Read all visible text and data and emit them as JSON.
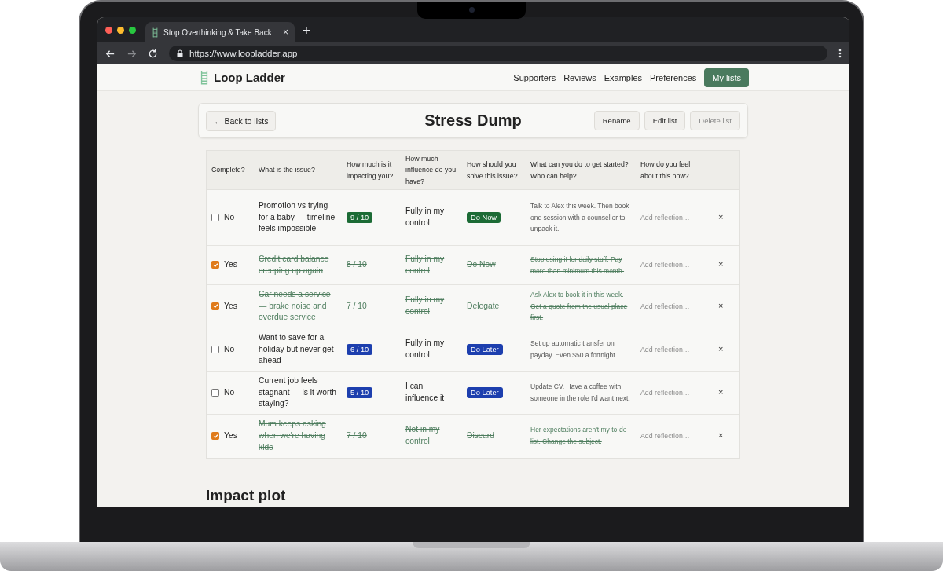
{
  "browser": {
    "tab_title": "Stop Overthinking & Take Back",
    "new_tab": "+",
    "tab_close": "×",
    "url": "https://www.loopladder.app"
  },
  "nav": {
    "brand": "Loop Ladder",
    "items": [
      {
        "label": "Supporters",
        "selected": false
      },
      {
        "label": "Reviews",
        "selected": false
      },
      {
        "label": "Examples",
        "selected": false
      },
      {
        "label": "Preferences",
        "selected": false
      },
      {
        "label": "My lists",
        "selected": true
      }
    ]
  },
  "header": {
    "back": "← Back to lists",
    "title": "Stress Dump",
    "actions": [
      {
        "label": "Rename",
        "disabled": false
      },
      {
        "label": "Edit list",
        "disabled": false
      },
      {
        "label": "Delete list",
        "disabled": true
      }
    ]
  },
  "table": {
    "columns": [
      "Complete?",
      "What is the issue?",
      "How much is it impacting you?",
      "How much influence do you have?",
      "How should you solve this issue?",
      "What can you do to get started? Who can help?",
      "How do you feel about this now?"
    ],
    "rows": [
      {
        "checked": false,
        "complete_label": "No",
        "issue": "Promotion vs trying for a baby — timeline feels impossible",
        "impact": {
          "text": "9 / 10",
          "color": "#1c6b35"
        },
        "influence": "Fully in my control",
        "approach": {
          "text": "Do Now",
          "color": "#1c6b35"
        },
        "action": "Talk to Alex this week. Then book one session with a counsellor to unpack it.",
        "reflection_placeholder": "Add reflection…",
        "delete": "×"
      },
      {
        "checked": true,
        "complete_label": "Yes",
        "issue": "Credit card balance creeping up again",
        "impact": {
          "text": "8 / 10"
        },
        "influence": "Fully in my control",
        "approach": {
          "text": "Do Now"
        },
        "action": "Stop using it for daily stuff. Pay more than minimum this month.",
        "reflection_placeholder": "Add reflection…",
        "delete": "×"
      },
      {
        "checked": true,
        "complete_label": "Yes",
        "issue": "Car needs a service — brake noise and overdue service",
        "impact": {
          "text": "7 / 10"
        },
        "influence": "Fully in my control",
        "approach": {
          "text": "Delegate"
        },
        "action": "Ask Alex to book it in this week. Get a quote from the usual place first.",
        "reflection_placeholder": "Add reflection…",
        "delete": "×"
      },
      {
        "checked": false,
        "complete_label": "No",
        "issue": "Want to save for a holiday but never get ahead",
        "impact": {
          "text": "6 / 10",
          "color": "#1d3fae"
        },
        "influence": "Fully in my control",
        "approach": {
          "text": "Do Later",
          "color": "#1d3fae"
        },
        "action": "Set up automatic transfer on payday. Even $50 a fortnight.",
        "reflection_placeholder": "Add reflection…",
        "delete": "×"
      },
      {
        "checked": false,
        "complete_label": "No",
        "issue": "Current job feels stagnant — is it worth staying?",
        "impact": {
          "text": "5 / 10",
          "color": "#1d3fae"
        },
        "influence": "I can influence it",
        "approach": {
          "text": "Do Later",
          "color": "#1d3fae"
        },
        "action": "Update CV. Have a coffee with someone in the role I'd want next.",
        "reflection_placeholder": "Add reflection…",
        "delete": "×"
      },
      {
        "checked": true,
        "complete_label": "Yes",
        "issue": "Mum keeps asking when we're having kids",
        "impact": {
          "text": "7 / 10"
        },
        "influence": "Not in my control",
        "approach": {
          "text": "Discard"
        },
        "action": "Her expectations aren't my to-do list. Change the subject.",
        "reflection_placeholder": "Add reflection…",
        "delete": "×"
      }
    ]
  },
  "section_title": "Impact plot"
}
